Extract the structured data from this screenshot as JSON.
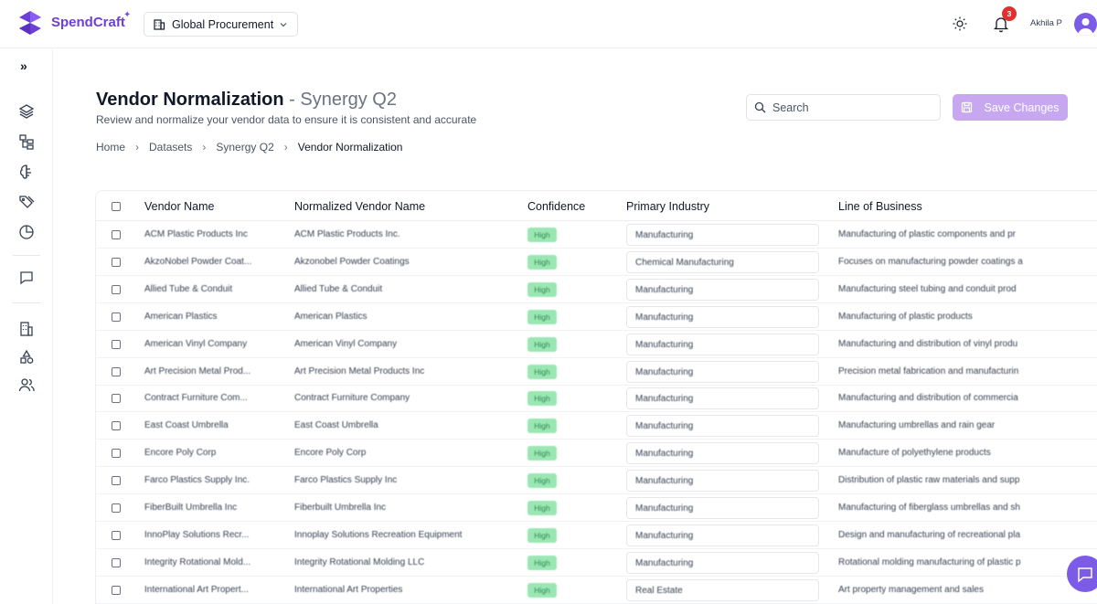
{
  "brand": {
    "name": "SpendCraft",
    "spark": "✦"
  },
  "workspace": {
    "label": "Global Procurement"
  },
  "header": {
    "notification_count": "3",
    "user_name": "Akhila P"
  },
  "page": {
    "title": "Vendor Normalization",
    "title_sep": " - ",
    "title_suffix": "Synergy Q2",
    "subtitle": "Review and normalize your vendor data to ensure it is consistent and accurate"
  },
  "breadcrumb": [
    "Home",
    "Datasets",
    "Synergy Q2",
    "Vendor Normalization"
  ],
  "search": {
    "placeholder": "Search"
  },
  "save_button": {
    "label": "Save Changes"
  },
  "sidebar": {
    "toggle_icon": "»",
    "items": [
      "layers-icon",
      "hierarchy-icon",
      "brain-icon",
      "tags-icon",
      "pie-chart-icon",
      "chat-icon",
      "building-icon",
      "shapes-icon",
      "users-icon"
    ]
  },
  "table": {
    "columns": [
      "Vendor Name",
      "Normalized Vendor Name",
      "Confidence",
      "Primary Industry",
      "Line of Business"
    ],
    "rows": [
      [
        "ACM Plastic Products Inc",
        "ACM Plastic Products Inc.",
        "High",
        "Manufacturing",
        "Manufacturing of plastic components and pr"
      ],
      [
        "AkzoNobel Powder Coat...",
        "Akzonobel Powder Coatings",
        "High",
        "Chemical Manufacturing",
        "Focuses on manufacturing powder coatings a"
      ],
      [
        "Allied Tube & Conduit",
        "Allied Tube & Conduit",
        "High",
        "Manufacturing",
        "Manufacturing steel tubing and conduit prod"
      ],
      [
        "American Plastics",
        "American Plastics",
        "High",
        "Manufacturing",
        "Manufacturing of plastic products"
      ],
      [
        "American Vinyl Company",
        "American Vinyl Company",
        "High",
        "Manufacturing",
        "Manufacturing and distribution of vinyl produ"
      ],
      [
        "Art Precision Metal Prod...",
        "Art Precision Metal Products Inc",
        "High",
        "Manufacturing",
        "Precision metal fabrication and manufacturin"
      ],
      [
        "Contract Furniture Com...",
        "Contract Furniture Company",
        "High",
        "Manufacturing",
        "Manufacturing and distribution of commercia"
      ],
      [
        "East Coast Umbrella",
        "East Coast Umbrella",
        "High",
        "Manufacturing",
        "Manufacturing umbrellas and rain gear"
      ],
      [
        "Encore Poly Corp",
        "Encore Poly Corp",
        "High",
        "Manufacturing",
        "Manufacture of polyethylene products"
      ],
      [
        "Farco Plastics Supply Inc.",
        "Farco Plastics Supply Inc",
        "High",
        "Manufacturing",
        "Distribution of plastic raw materials and supp"
      ],
      [
        "FiberBuilt Umbrella Inc",
        "Fiberbuilt Umbrella Inc",
        "High",
        "Manufacturing",
        "Manufacturing of fiberglass umbrellas and sh"
      ],
      [
        "InnoPlay Solutions Recr...",
        "Innoplay Solutions Recreation Equipment",
        "High",
        "Manufacturing",
        "Design and manufacturing of recreational pla"
      ],
      [
        "Integrity Rotational Mold...",
        "Integrity Rotational Molding LLC",
        "High",
        "Manufacturing",
        "Rotational molding manufacturing of plastic p"
      ],
      [
        "International Art Propert...",
        "International Art Properties",
        "High",
        "Real Estate",
        "Art property management and sales"
      ]
    ]
  },
  "colors": {
    "brand": "#6d3fd6",
    "save_disabled": "#c7a8f0",
    "confidence_high": "#9be7b4",
    "badge": "#e03131"
  }
}
